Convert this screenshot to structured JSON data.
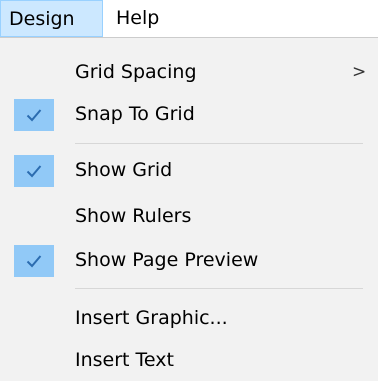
{
  "menubar": {
    "items": [
      {
        "label": "Design",
        "active": true
      },
      {
        "label": "Help",
        "active": false
      }
    ]
  },
  "dropdown": {
    "items": [
      {
        "label": "Grid Spacing",
        "checked": false,
        "has_submenu": true,
        "submenu_indicator": ">"
      },
      {
        "label": "Snap To Grid",
        "checked": true
      },
      {
        "label": "Show Grid",
        "checked": true
      },
      {
        "label": "Show Rulers",
        "checked": false
      },
      {
        "label": "Show Page Preview",
        "checked": true
      },
      {
        "label": "Insert Graphic...",
        "checked": false
      },
      {
        "label": "Insert Text",
        "checked": false
      }
    ]
  },
  "icons": {
    "check": "checkmark-icon",
    "submenu": "chevron-right-icon"
  },
  "colors": {
    "menubar_active_bg": "#cce8ff",
    "menubar_active_border": "#99d1ff",
    "menu_bg": "#f2f2f2",
    "check_bg": "#91c9f7",
    "check_mark": "#2b6cb0",
    "separator": "#d7d7d7"
  }
}
